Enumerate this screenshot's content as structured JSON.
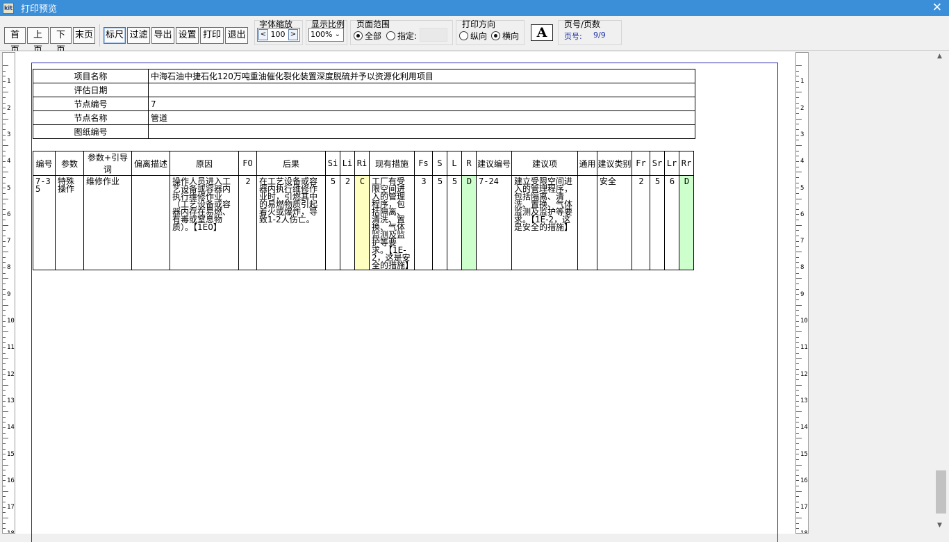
{
  "window": {
    "title": "打印预览",
    "icon": "kit-icon",
    "close_glyph": "✕"
  },
  "toolbar": {
    "nav_buttons": [
      "首页",
      "上页",
      "下页",
      "末页"
    ],
    "action_buttons": [
      "标尺",
      "过滤",
      "导出",
      "设置",
      "打印",
      "退出"
    ],
    "font_scale": {
      "label": "字体缩放",
      "dec": "<",
      "value": "100",
      "inc": ">"
    },
    "display_ratio": {
      "label": "显示比例",
      "value": "100%"
    },
    "page_range": {
      "label": "页面范围",
      "all": "全部",
      "specify": "指定:"
    },
    "orientation": {
      "label": "打印方向",
      "portrait": "纵向",
      "landscape": "横向"
    },
    "font_button": "A",
    "page_info": {
      "label": "页号/页数",
      "page_label": "页号:",
      "value": "9/9"
    }
  },
  "info_table": [
    {
      "label": "项目名称",
      "value": "中海石油中捷石化120万吨重油催化裂化装置深度脱硫并予以资源化利用项目"
    },
    {
      "label": "评估日期",
      "value": ""
    },
    {
      "label": "节点编号",
      "value": "7"
    },
    {
      "label": "节点名称",
      "value": "管道"
    },
    {
      "label": "图纸编号",
      "value": ""
    }
  ],
  "main_table": {
    "headers": [
      "编号",
      "参数",
      "参数+引导词",
      "偏离描述",
      "原因",
      "FO",
      "后果",
      "Si",
      "Li",
      "Ri",
      "现有措施",
      "Fs",
      "S",
      "L",
      "R",
      "建议编号",
      "建议项",
      "通用",
      "建议类别",
      "Fr",
      "Sr",
      "Lr",
      "Rr"
    ],
    "rows": [
      {
        "id": "7-35",
        "param": "特殊操作",
        "param_guide": "维修作业",
        "deviation": "",
        "cause": "操作人员进入工艺设备或容器内执行维修作业（工艺设备或容器内存在易燃、有毒或窒息物质）。【1E0】",
        "fo": "2",
        "consequence": "在工艺设备或容器内执行维修作业时，引燃其中的易燃物质引起着火或爆炸，导致1-2人伤亡。",
        "si": "5",
        "li": "2",
        "ri": "C",
        "existing": "工厂有受限空间进入的管理程序，包括隔离、清洗、置换、气体监测及监护等要求。【1E-2，这是安全的措施】",
        "fs": "3",
        "s": "5",
        "l": "5",
        "r": "D",
        "rec_id": "7-24",
        "recommendation": "建立受限空间进入的管理程序，包括隔离、清洗、置换、气体监测及监护等要求。【1E-2，这是安全的措施】",
        "general": "",
        "category": "安全",
        "fr": "2",
        "sr": "5",
        "lr": "6",
        "rr": "D"
      }
    ]
  },
  "ruler": {
    "numbers": [
      "1",
      "2",
      "3",
      "4",
      "5",
      "6",
      "7",
      "8",
      "9",
      "10",
      "11",
      "12",
      "13",
      "14",
      "15",
      "16",
      "17",
      "18"
    ]
  },
  "colors": {
    "titlebar": "#3b8ed8",
    "ri_highlight": "#ffffbf",
    "r_highlight": "#ccffcc",
    "page_frame": "#2a2ab0"
  }
}
